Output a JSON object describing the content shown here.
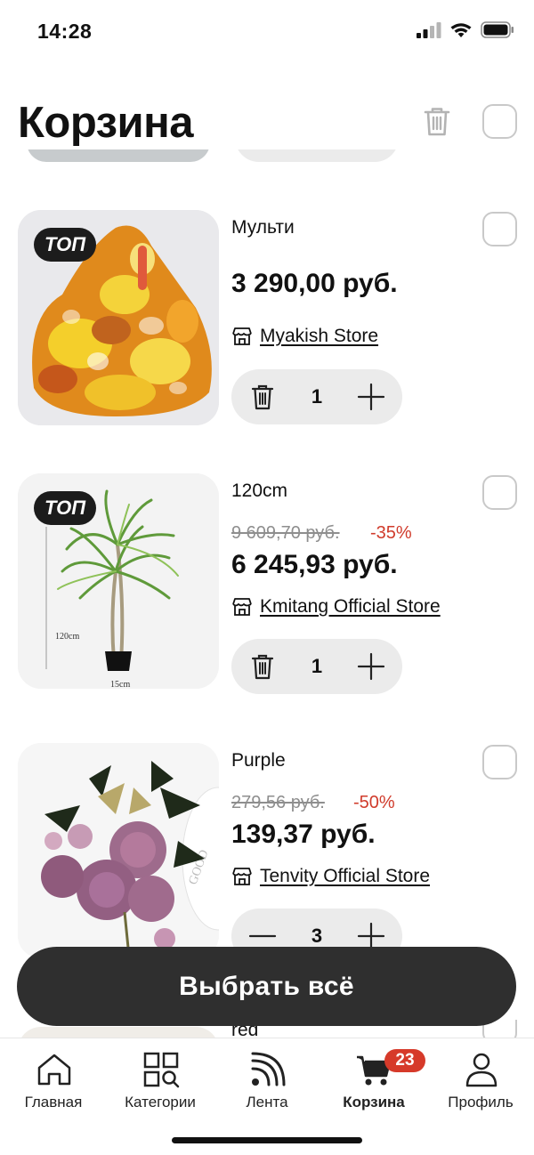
{
  "status_bar": {
    "time": "14:28"
  },
  "header": {
    "title": "Корзина"
  },
  "items": [
    {
      "badge": "ТОП",
      "title": "Мульти",
      "price": "3 290,00 руб.",
      "store": "Myakish Store",
      "quantity": "1"
    },
    {
      "badge": "ТОП",
      "title": "120cm",
      "old_price": "9 609,70 руб.",
      "discount": "-35%",
      "price": "6 245,93 руб.",
      "store": "Kmitang Official Store",
      "quantity": "1",
      "image_labels": {
        "height": "120cm",
        "width": "15cm"
      }
    },
    {
      "title": "Purple",
      "old_price": "279,56 руб.",
      "discount": "-50%",
      "price": "139,37 руб.",
      "store": "Tenvity Official Store",
      "quantity": "3",
      "image_labels": {
        "vase": "GOOD"
      }
    },
    {
      "title": "red"
    }
  ],
  "select_all_button": "Выбрать всё",
  "tabbar": {
    "tabs": [
      {
        "label": "Главная",
        "icon": "home-icon"
      },
      {
        "label": "Категории",
        "icon": "categories-icon"
      },
      {
        "label": "Лента",
        "icon": "feed-icon"
      },
      {
        "label": "Корзина",
        "icon": "cart-icon",
        "badge": "23",
        "active": true
      },
      {
        "label": "Профиль",
        "icon": "profile-icon"
      }
    ]
  },
  "colors": {
    "accent": "#d63a2a",
    "button": "#2f2f2f",
    "stepper": "#ebebeb"
  }
}
